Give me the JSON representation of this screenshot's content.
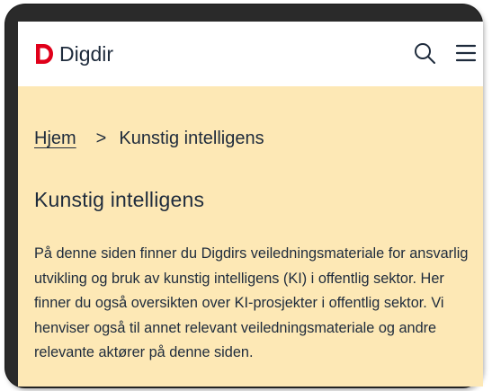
{
  "header": {
    "logo_text": "Digdir",
    "logo_color": "#e0001a",
    "search_icon": "search-icon",
    "menu_icon": "hamburger-menu-icon"
  },
  "breadcrumb": {
    "home_label": "Hjem",
    "separator": ">",
    "current_label": "Kunstig intelligens"
  },
  "main": {
    "title": "Kunstig intelligens",
    "intro": "På denne siden finner du Digdirs veiledningsmateriale for ansvarlig utvikling og bruk av kunstig intelligens (KI) i offentlig sektor. Her finner du også oversikten over KI-prosjekter i offentlig sektor. Vi henviser også til annet relevant veiledningsmateriale og andre relevante aktører på denne siden."
  },
  "colors": {
    "background": "#fde8b5",
    "header_bg": "#ffffff",
    "text": "#1e2b3c",
    "device_frame": "#2a2a2a"
  }
}
